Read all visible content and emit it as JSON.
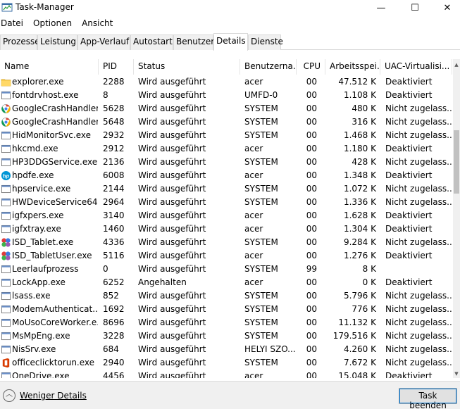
{
  "window": {
    "title": "Task-Manager",
    "minimize": "—",
    "maximize": "☐",
    "close": "✕"
  },
  "menu": [
    "Datei",
    "Optionen",
    "Ansicht"
  ],
  "tabs": [
    "Prozesse",
    "Leistung",
    "App-Verlauf",
    "Autostart",
    "Benutzer",
    "Details",
    "Dienste"
  ],
  "active_tab": "Details",
  "columns": [
    "Name",
    "PID",
    "Status",
    "Benutzerna...",
    "CPU",
    "Arbeitsspei...",
    "UAC-Virtualisi..."
  ],
  "processes": [
    {
      "name": "explorer.exe",
      "pid": "2288",
      "status": "Wird ausgeführt",
      "user": "acer",
      "cpu": "00",
      "mem": "47.512 K",
      "uac": "Deaktiviert",
      "icon": "folder-icon"
    },
    {
      "name": "fontdrvhost.exe",
      "pid": "8",
      "status": "Wird ausgeführt",
      "user": "UMFD-0",
      "cpu": "00",
      "mem": "1.108 K",
      "uac": "Deaktiviert",
      "icon": "window-icon"
    },
    {
      "name": "GoogleCrashHandler....",
      "pid": "5628",
      "status": "Wird ausgeführt",
      "user": "SYSTEM",
      "cpu": "00",
      "mem": "480 K",
      "uac": "Nicht zugelass...",
      "icon": "google-icon"
    },
    {
      "name": "GoogleCrashHandler...",
      "pid": "5648",
      "status": "Wird ausgeführt",
      "user": "SYSTEM",
      "cpu": "00",
      "mem": "316 K",
      "uac": "Nicht zugelass...",
      "icon": "google-icon"
    },
    {
      "name": "HidMonitorSvc.exe",
      "pid": "2932",
      "status": "Wird ausgeführt",
      "user": "SYSTEM",
      "cpu": "00",
      "mem": "1.468 K",
      "uac": "Nicht zugelass...",
      "icon": "window-icon"
    },
    {
      "name": "hkcmd.exe",
      "pid": "2912",
      "status": "Wird ausgeführt",
      "user": "acer",
      "cpu": "00",
      "mem": "1.180 K",
      "uac": "Deaktiviert",
      "icon": "window-icon"
    },
    {
      "name": "HP3DDGService.exe",
      "pid": "2136",
      "status": "Wird ausgeführt",
      "user": "SYSTEM",
      "cpu": "00",
      "mem": "428 K",
      "uac": "Nicht zugelass...",
      "icon": "window-icon"
    },
    {
      "name": "hpdfe.exe",
      "pid": "6008",
      "status": "Wird ausgeführt",
      "user": "acer",
      "cpu": "00",
      "mem": "1.348 K",
      "uac": "Deaktiviert",
      "icon": "hp-icon"
    },
    {
      "name": "hpservice.exe",
      "pid": "2144",
      "status": "Wird ausgeführt",
      "user": "SYSTEM",
      "cpu": "00",
      "mem": "1.072 K",
      "uac": "Nicht zugelass...",
      "icon": "window-icon"
    },
    {
      "name": "HWDeviceService64....",
      "pid": "2964",
      "status": "Wird ausgeführt",
      "user": "SYSTEM",
      "cpu": "00",
      "mem": "1.336 K",
      "uac": "Nicht zugelass...",
      "icon": "window-icon"
    },
    {
      "name": "igfxpers.exe",
      "pid": "3140",
      "status": "Wird ausgeführt",
      "user": "acer",
      "cpu": "00",
      "mem": "1.628 K",
      "uac": "Deaktiviert",
      "icon": "window-icon"
    },
    {
      "name": "igfxtray.exe",
      "pid": "1460",
      "status": "Wird ausgeführt",
      "user": "acer",
      "cpu": "00",
      "mem": "1.304 K",
      "uac": "Deaktiviert",
      "icon": "window-icon"
    },
    {
      "name": "ISD_Tablet.exe",
      "pid": "4336",
      "status": "Wird ausgeführt",
      "user": "SYSTEM",
      "cpu": "00",
      "mem": "9.284 K",
      "uac": "Nicht zugelass...",
      "icon": "tablet-icon"
    },
    {
      "name": "ISD_TabletUser.exe",
      "pid": "5116",
      "status": "Wird ausgeführt",
      "user": "acer",
      "cpu": "00",
      "mem": "1.276 K",
      "uac": "Deaktiviert",
      "icon": "tablet-icon"
    },
    {
      "name": "Leerlaufprozess",
      "pid": "0",
      "status": "Wird ausgeführt",
      "user": "SYSTEM",
      "cpu": "99",
      "mem": "8 K",
      "uac": "",
      "icon": "window-icon"
    },
    {
      "name": "LockApp.exe",
      "pid": "6252",
      "status": "Angehalten",
      "user": "acer",
      "cpu": "00",
      "mem": "0 K",
      "uac": "Deaktiviert",
      "icon": "window-icon"
    },
    {
      "name": "lsass.exe",
      "pid": "852",
      "status": "Wird ausgeführt",
      "user": "SYSTEM",
      "cpu": "00",
      "mem": "5.796 K",
      "uac": "Nicht zugelass...",
      "icon": "window-icon"
    },
    {
      "name": "ModemAuthenticat...",
      "pid": "1692",
      "status": "Wird ausgeführt",
      "user": "SYSTEM",
      "cpu": "00",
      "mem": "776 K",
      "uac": "Nicht zugelass...",
      "icon": "window-icon"
    },
    {
      "name": "MoUsoCoreWorker.e...",
      "pid": "8696",
      "status": "Wird ausgeführt",
      "user": "SYSTEM",
      "cpu": "00",
      "mem": "11.132 K",
      "uac": "Nicht zugelass...",
      "icon": "window-icon"
    },
    {
      "name": "MsMpEng.exe",
      "pid": "3228",
      "status": "Wird ausgeführt",
      "user": "SYSTEM",
      "cpu": "00",
      "mem": "179.516 K",
      "uac": "Nicht zugelass...",
      "icon": "window-icon"
    },
    {
      "name": "NisSrv.exe",
      "pid": "684",
      "status": "Wird ausgeführt",
      "user": "HELYI SZO...",
      "cpu": "00",
      "mem": "4.260 K",
      "uac": "Nicht zugelass...",
      "icon": "window-icon"
    },
    {
      "name": "officeclicktorun.exe",
      "pid": "2940",
      "status": "Wird ausgeführt",
      "user": "SYSTEM",
      "cpu": "00",
      "mem": "7.672 K",
      "uac": "Nicht zugelass...",
      "icon": "office-icon"
    },
    {
      "name": "OneDrive.exe",
      "pid": "4456",
      "status": "Wird ausgeführt",
      "user": "acer",
      "cpu": "00",
      "mem": "15.048 K",
      "uac": "Deaktiviert",
      "icon": "window-icon"
    }
  ],
  "footer": {
    "fewer_details": "Weniger Details",
    "end_task": "Task beenden"
  }
}
